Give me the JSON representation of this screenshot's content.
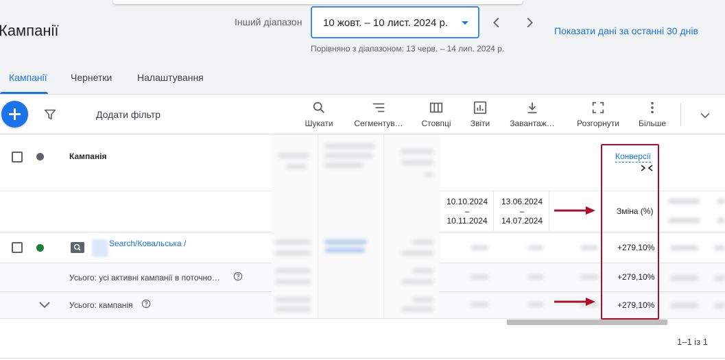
{
  "header": {
    "page_title": "Кампанії",
    "range_label": "Інший діапазон",
    "date_range": "10 жовт. – 10 лист. 2024 р.",
    "compare_text": "Порівняно з діапазоном: 13 черв. – 14 лип. 2024 р.",
    "show_last_30": "Показати дані за останні 30 днів"
  },
  "tabs": [
    {
      "label": "Кампанії",
      "active": true
    },
    {
      "label": "Чернетки",
      "active": false
    },
    {
      "label": "Налаштування",
      "active": false
    }
  ],
  "toolbar": {
    "add_filter": "Додати фільтр",
    "tools": [
      {
        "icon": "search-icon",
        "label": "Шукати"
      },
      {
        "icon": "segment-icon",
        "label": "Сегментув…"
      },
      {
        "icon": "columns-icon",
        "label": "Стовпці"
      },
      {
        "icon": "reports-icon",
        "label": "Звіти"
      },
      {
        "icon": "download-icon",
        "label": "Завантаж…"
      },
      {
        "icon": "fullscreen-icon",
        "label": "Розгорнути"
      },
      {
        "icon": "more-vert-icon",
        "label": "Більше"
      }
    ]
  },
  "table": {
    "campaign_header": "Кампанія",
    "conversions_header": "Конверсії",
    "date_ranges": [
      {
        "start": "10.10.2024",
        "dash": "–",
        "end": "10.11.2024"
      },
      {
        "start": "13.06.2024",
        "dash": "–",
        "end": "14.07.2024"
      }
    ],
    "change_header": "Зміна (%)",
    "campaign_row": {
      "name": "Search/Ковальська /",
      "change": "+279,10%"
    },
    "total_active": {
      "label": "Усього: усі активні кампанії в поточно…",
      "change": "+279,10%"
    },
    "total_campaign": {
      "label": "Усього: кампанія",
      "change": "+279,10%"
    }
  },
  "pagination": "1–1 із 1",
  "colors": {
    "accent": "#1a73e8",
    "highlight": "#b00d2b",
    "status_enabled": "#188038",
    "status_neutral": "#5f6368"
  }
}
